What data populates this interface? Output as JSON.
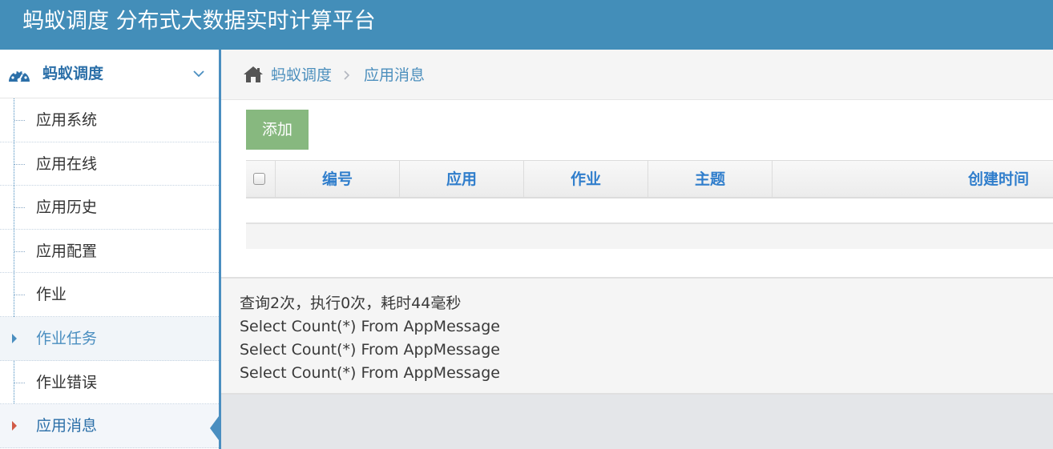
{
  "header": {
    "title": "蚂蚁调度 分布式大数据实时计算平台"
  },
  "sidebar": {
    "group_title": "蚂蚁调度",
    "items": [
      {
        "label": "应用系统",
        "state": "normal"
      },
      {
        "label": "应用在线",
        "state": "normal"
      },
      {
        "label": "应用历史",
        "state": "normal"
      },
      {
        "label": "应用配置",
        "state": "normal"
      },
      {
        "label": "作业",
        "state": "normal"
      },
      {
        "label": "作业任务",
        "state": "hover"
      },
      {
        "label": "作业错误",
        "state": "normal"
      },
      {
        "label": "应用消息",
        "state": "active"
      }
    ]
  },
  "breadcrumb": {
    "home": "蚂蚁调度",
    "current": "应用消息"
  },
  "toolbar": {
    "add_label": "添加"
  },
  "table": {
    "columns": [
      "编号",
      "应用",
      "作业",
      "主题",
      "创建时间"
    ]
  },
  "stats": {
    "lines": [
      "查询2次，执行0次，耗时44毫秒",
      "Select Count(*) From AppMessage",
      "Select Count(*) From AppMessage",
      "Select Count(*) From AppMessage"
    ]
  },
  "colors": {
    "header_bg": "#438eb9",
    "sidebar_accent": "#4a8ec0",
    "add_button": "#87b87f",
    "active_arrow": "#d15b47",
    "column_header_text": "#307ecc"
  }
}
